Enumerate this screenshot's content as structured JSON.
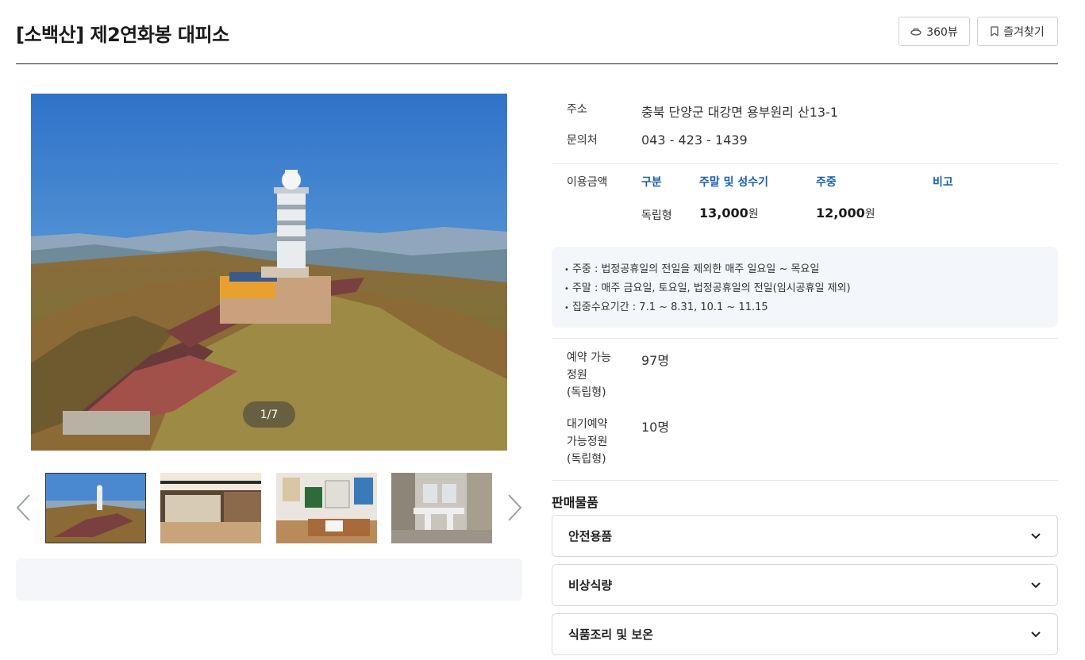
{
  "page": {
    "title": "[소백산] 제2연화봉 대피소",
    "buttons": {
      "view360": "360뷰",
      "favorite": "즐겨찾기"
    }
  },
  "gallery": {
    "counter": "1/7"
  },
  "info": {
    "address_label": "주소",
    "address": "충북 단양군 대강면 용부원리 산13-1",
    "contact_label": "문의처",
    "contact": "043 - 423 - 1439",
    "fee_label": "이용금액",
    "fee_table": {
      "headers": [
        "구분",
        "주말 및 성수기",
        "주중",
        "비고"
      ],
      "row": {
        "type": "독립형",
        "weekend_amount": "13,000",
        "weekday_amount": "12,000",
        "unit": "원",
        "note": ""
      }
    },
    "notes": [
      "주중 : 법정공휴일의 전일을 제외한 매주 일요일 ~ 목요일",
      "주말 : 매주 금요일, 토요일, 법정공휴일의 전일(임시공휴일 제외)",
      "집중수요기간 : 7.1 ~ 8.31, 10.1 ~ 11.15"
    ],
    "capacity": {
      "reserve_label_lines": [
        "예약 가능",
        "정원",
        "(독립형)"
      ],
      "reserve_value": "97명",
      "waiting_label_lines": [
        "대기예약",
        "가능정원",
        "(독립형)"
      ],
      "waiting_value": "10명"
    }
  },
  "sales": {
    "title": "판매물품",
    "items": [
      "안전용품",
      "비상식량",
      "식품조리 및 보온"
    ]
  }
}
